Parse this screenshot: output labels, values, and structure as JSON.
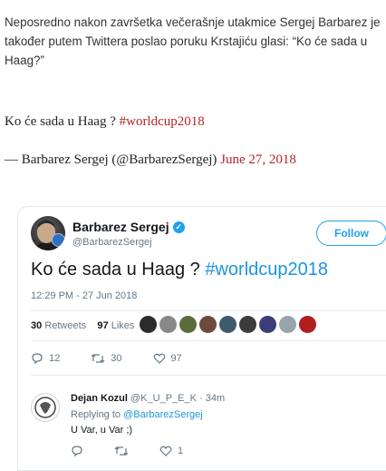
{
  "article": {
    "intro": "Neposredno nakon završetka večerašnje utakmice Sergej Barbarez je također putem Twittera poslao poruku Krstajiću glasi: “Ko će sada u Haag?”",
    "quote_text": "Ko će sada u Haag ?",
    "quote_hashtag": "#worldcup2018",
    "attribution": "— Barbarez Sergej (@BarbarezSergej)",
    "attribution_date": "June 27, 2018"
  },
  "tweet": {
    "name": "Barbarez Sergej",
    "handle": "@BarbarezSergej",
    "follow_label": "Follow",
    "text": "Ko će sada u Haag ?",
    "hashtag": "#worldcup2018",
    "timestamp": "12:29 PM - 27 Jun 2018",
    "retweets_count": "30",
    "retweets_label": "Retweets",
    "likes_count": "97",
    "likes_label": "Likes",
    "reply_count": "12",
    "retweet_count": "30",
    "like_count": "97",
    "likers": [
      "#2b2b2b",
      "#888888",
      "#5b6b3a",
      "#6d4a3a",
      "#3f5a6b",
      "#3c3c3c",
      "#3a3f7a",
      "#9aa4ad",
      "#b01e1e"
    ]
  },
  "reply": {
    "name": "Dejan Kozul",
    "handle": "@K_U_P_E_K",
    "time": "· 34m",
    "replying_to_label": "Replying to",
    "replying_to_handle": "@BarbarezSergej",
    "text": "U Var, u Var ;)",
    "like_count": "1"
  }
}
